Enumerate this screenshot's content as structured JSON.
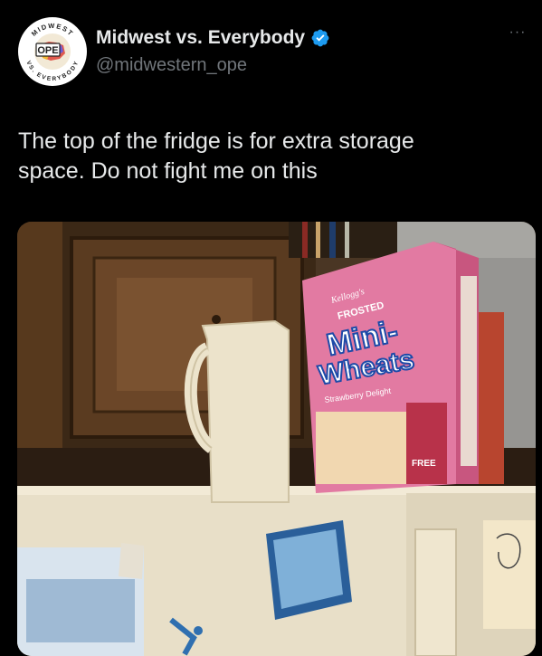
{
  "author": {
    "display_name": "Midwest vs. Everybody",
    "handle": "@midwestern_ope",
    "verified": true,
    "verified_color": "#1d9bf0",
    "avatar": {
      "ring_text_top": "MIDWEST",
      "center_text": "OPE",
      "ring_text_bottom": "VS. EVERYBODY"
    }
  },
  "more_button": {
    "icon": "more-horizontal-icon",
    "label": "···"
  },
  "tweet": {
    "lines": [
      "The top of the fridge is for extra storage",
      "space. Do not fight me on this"
    ]
  },
  "photo": {
    "cereal_box": {
      "brand": "Kellogg's",
      "variety_top": "FROSTED",
      "name_line1": "Mini-",
      "name_line2": "Wheats",
      "flavor": "Strawberry Delight",
      "promo": "FREE"
    }
  },
  "colors": {
    "background": "#000000",
    "text_primary": "#e7e9ea",
    "text_secondary": "#71767b"
  }
}
